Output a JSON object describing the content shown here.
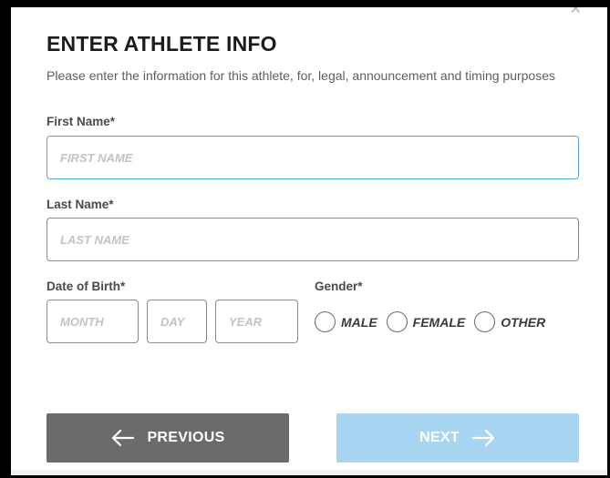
{
  "header": {
    "title": "ENTER ATHLETE INFO",
    "subtitle": "Please enter the information for this athlete, for, legal, announcement and timing purposes",
    "close_icon": "close-icon"
  },
  "form": {
    "first_name": {
      "label": "First Name*",
      "placeholder": "FIRST NAME",
      "value": "",
      "focused": true
    },
    "last_name": {
      "label": "Last Name*",
      "placeholder": "LAST NAME",
      "value": ""
    },
    "dob": {
      "label": "Date of Birth*",
      "month_placeholder": "MONTH",
      "day_placeholder": "DAY",
      "year_placeholder": "YEAR"
    },
    "gender": {
      "label": "Gender*",
      "options": [
        {
          "label": "MALE",
          "selected": false
        },
        {
          "label": "FEMALE",
          "selected": false
        },
        {
          "label": "OTHER",
          "selected": false
        }
      ]
    }
  },
  "buttons": {
    "previous_label": "PREVIOUS",
    "next_label": "NEXT",
    "previous_icon": "arrow-left-icon",
    "next_icon": "arrow-right-icon"
  },
  "colors": {
    "focus_border": "#55a9d8",
    "previous_bg": "#6b6b6b",
    "next_bg_disabled": "#a8d5f1"
  }
}
